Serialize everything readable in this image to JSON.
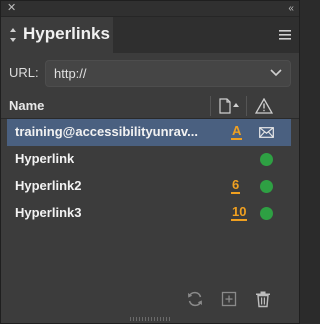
{
  "panel": {
    "title": "Hyperlinks"
  },
  "url": {
    "label": "URL:",
    "value": "http://"
  },
  "list": {
    "header_name": "Name"
  },
  "rows": [
    {
      "name": "training@accessibilityunrav...",
      "page": "A",
      "status": "email",
      "selected": true
    },
    {
      "name": "Hyperlink",
      "page": "",
      "status": "ok",
      "selected": false
    },
    {
      "name": "Hyperlink2",
      "page": "6",
      "status": "ok",
      "selected": false
    },
    {
      "name": "Hyperlink3",
      "page": "10",
      "status": "ok",
      "selected": false
    }
  ],
  "colors": {
    "selected_row": "#4a6080",
    "page_link": "#f0a020",
    "status_ok": "#2ea043"
  },
  "icons": {
    "close": "close-icon",
    "collapse": "double-chevron-icon",
    "panel_menu": "hamburger-menu-icon",
    "sort": "page-sort-icon",
    "warning": "warning-icon",
    "refresh": "refresh-icon",
    "new": "new-hyperlink-icon",
    "delete": "trash-icon"
  }
}
